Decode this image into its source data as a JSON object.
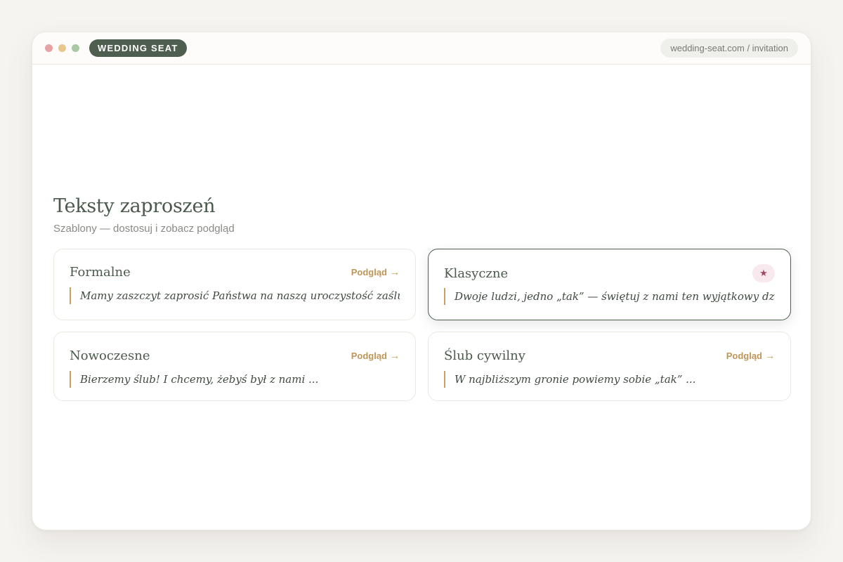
{
  "browser": {
    "brand": "WEDDING SEAT",
    "url": "wedding-seat.com / invitation",
    "dots": [
      "#e6a3a6",
      "#e8c78c",
      "#a9c9a3"
    ]
  },
  "page": {
    "title": "Teksty zaproszeń",
    "subtitle": "Szablony — dostosuj i zobacz podgląd"
  },
  "templates": [
    {
      "title": "Formalne",
      "action": "Podgląd",
      "arrow": "→",
      "excerpt": "Mamy zaszczyt zaprosić Państwa na naszą uroczystość zaślubin ..."
    },
    {
      "title": "Klasyczne",
      "badge": "★",
      "selected": true,
      "excerpt": "Dwoje ludzi, jedno „tak” — świętuj z nami ten wyjątkowy dzień ..."
    },
    {
      "title": "Nowoczesne",
      "action": "Podgląd",
      "arrow": "→",
      "excerpt": "Bierzemy ślub! I chcemy, żebyś był z nami ..."
    },
    {
      "title": "Ślub cywilny",
      "action": "Podgląd",
      "arrow": "→",
      "excerpt": "W najbliższym gronie powiemy sobie „tak” ..."
    }
  ],
  "colors": {
    "brand_green": "#4e5e4f",
    "accent_gold": "#c09557",
    "badge_pink": "#f8e9ee",
    "badge_star": "#a14765"
  }
}
